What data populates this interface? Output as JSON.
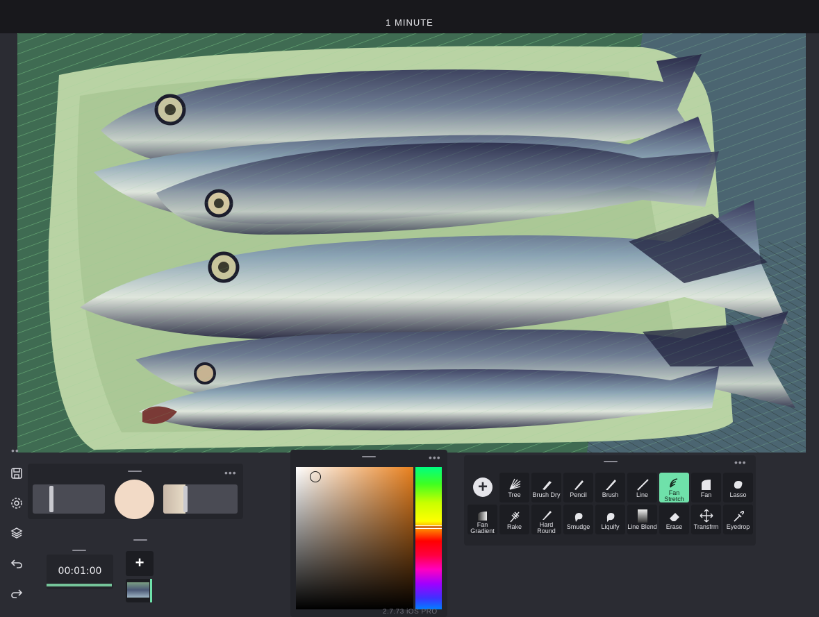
{
  "top_bar": {
    "title": "1 MINUTE"
  },
  "canvas": {
    "subject": "painting"
  },
  "left_rail": [
    {
      "name": "save-icon"
    },
    {
      "name": "settings-icon"
    },
    {
      "name": "layers-icon"
    },
    {
      "name": "undo-icon"
    },
    {
      "name": "redo-icon"
    }
  ],
  "color_panel": {
    "current_color": "#f2dac6",
    "size_slider_level": 0.28,
    "opacity_slider_level": 0.3
  },
  "timelapse": {
    "time": "00:01:00",
    "progress": 1.0
  },
  "layers": {
    "add_label": "+"
  },
  "picker": {
    "hue_marker": "#d4701e"
  },
  "brushes": {
    "row1": [
      "Tree",
      "Brush Dry",
      "Pencil",
      "Brush",
      "Line",
      "Fan Stretch",
      "Fan",
      "Lasso"
    ],
    "row2": [
      "Fan Gradient",
      "Rake",
      "Hard Round",
      "Smudge",
      "Liquify",
      "Line Blend",
      "Erase",
      "Transfrm",
      "Eyedrop"
    ],
    "active": "Fan Stretch"
  },
  "version": "2.7.73 iOS PRO",
  "colors": {
    "accent": "#6fe1aa",
    "panel": "#24252b",
    "background": "#2b2c33"
  }
}
